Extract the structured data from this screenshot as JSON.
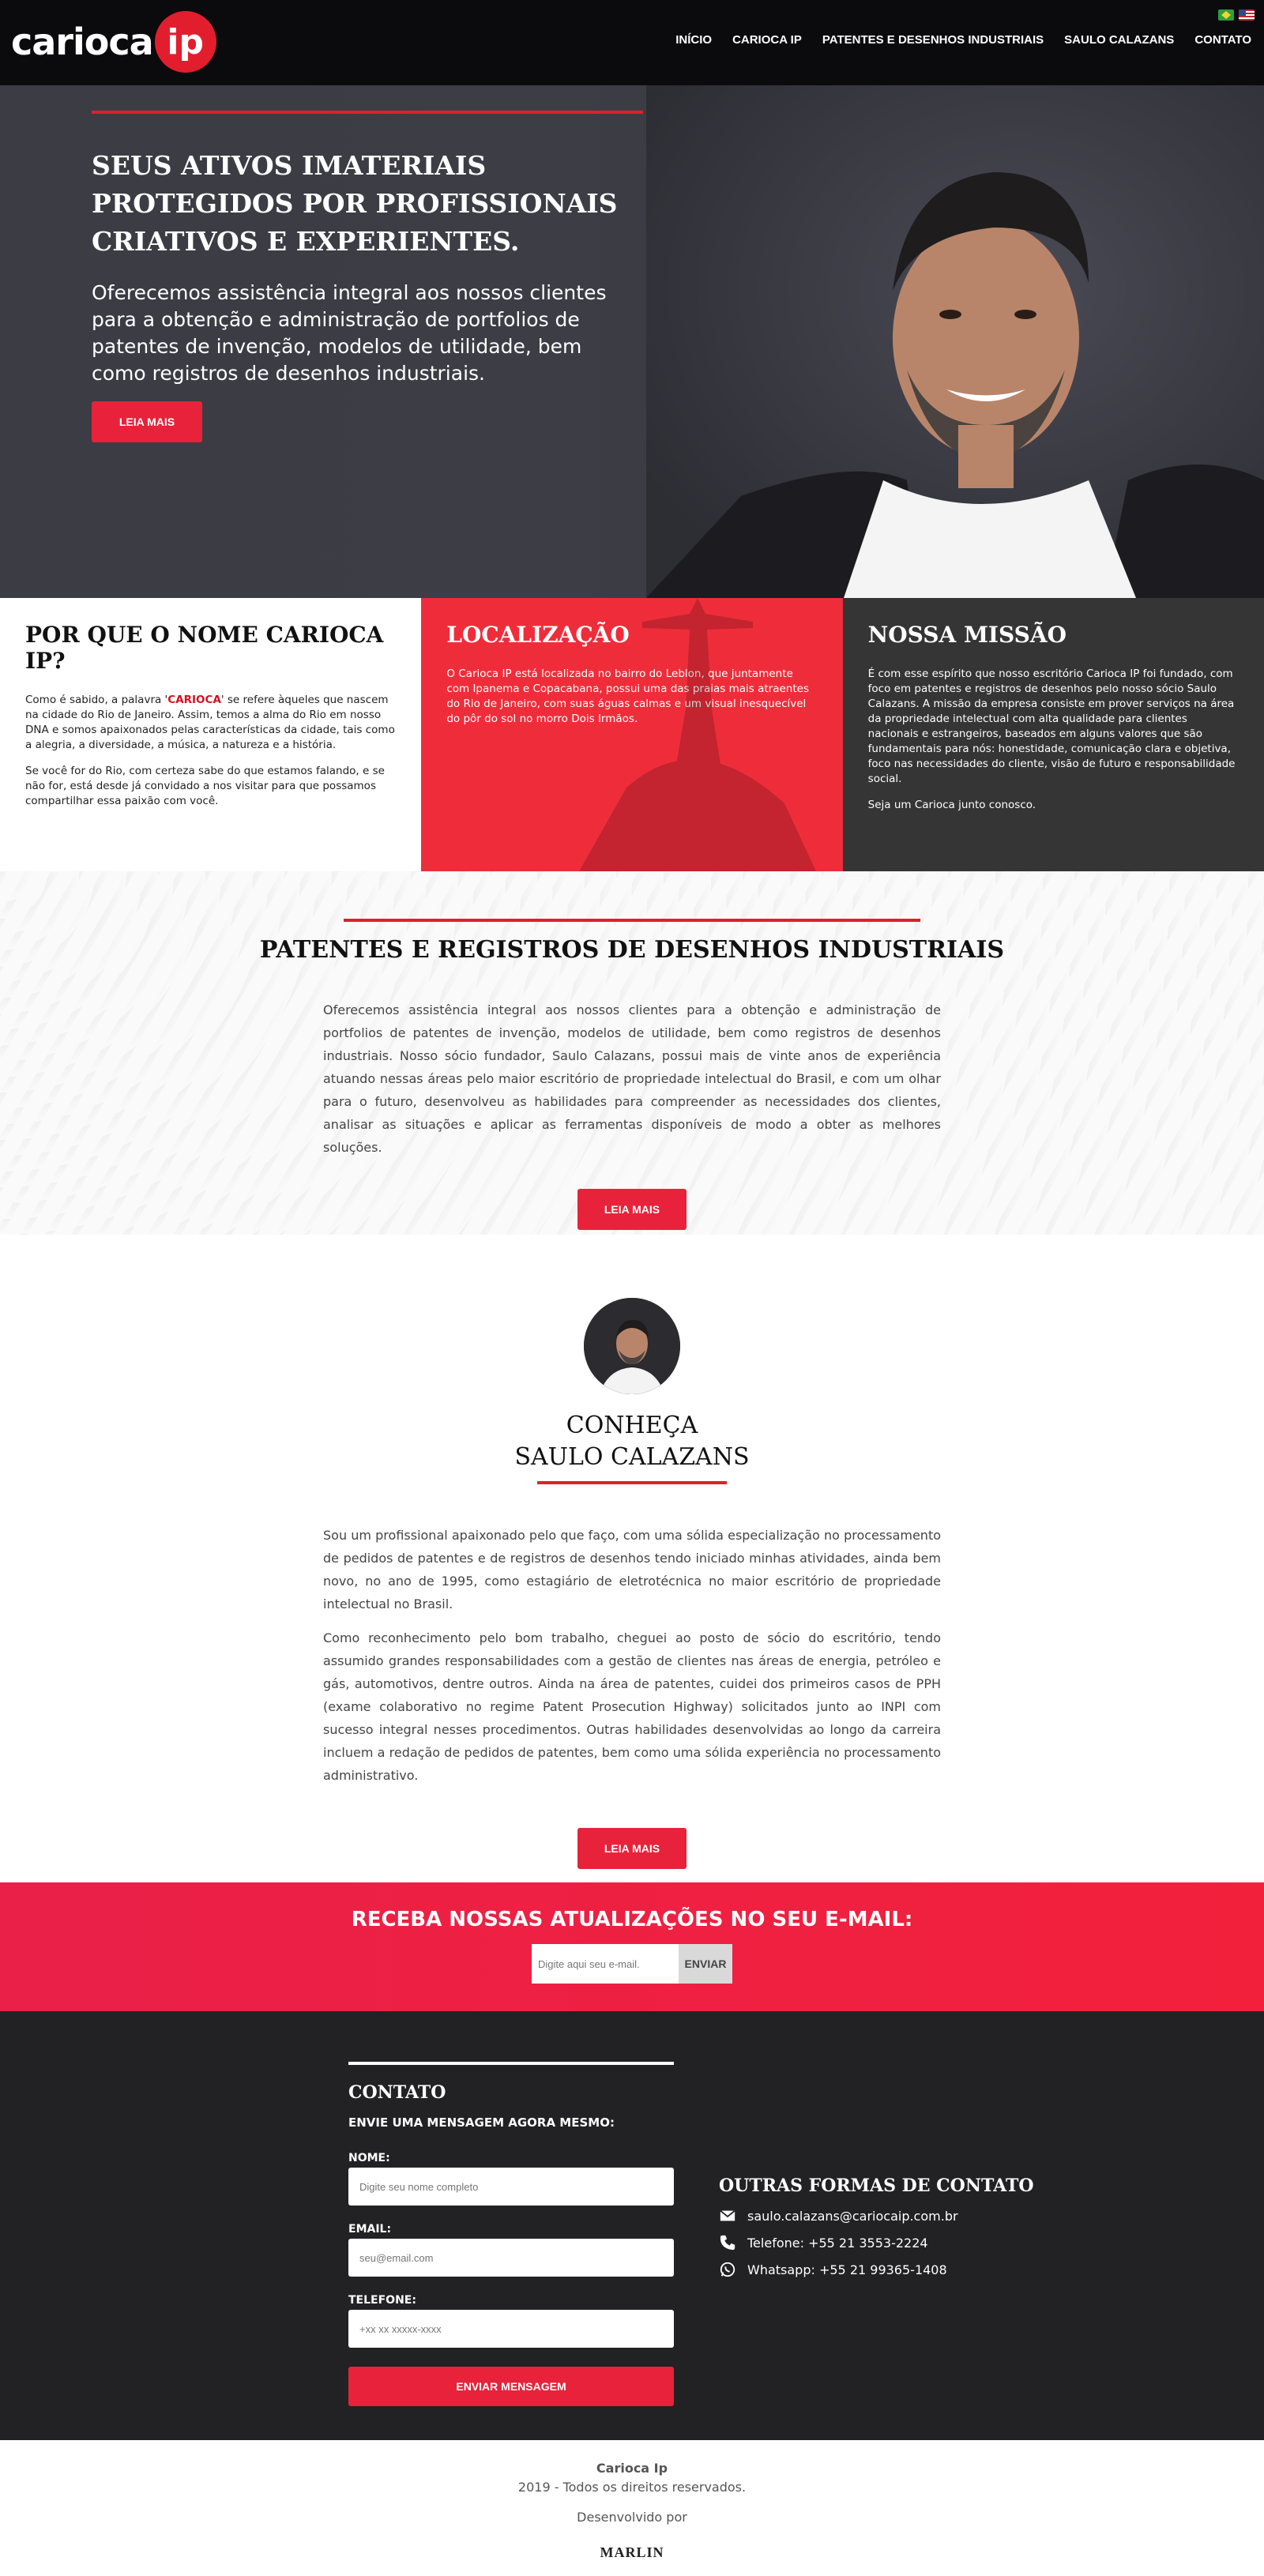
{
  "header": {
    "logo_text": "carioca",
    "logo_badge": "ip",
    "nav": [
      "INÍCIO",
      "CARIOCA IP",
      "PATENTES E DESENHOS INDUSTRIAIS",
      "SAULO CALAZANS",
      "CONTATO"
    ]
  },
  "hero": {
    "title": "SEUS ATIVOS IMATERIAIS PROTEGIDOS POR PROFISSIONAIS CRIATIVOS E EXPERIENTES.",
    "text": "Oferecemos assistência integral aos nossos clientes para a obtenção e administração de portfolios de patentes de invenção, modelos de utilidade, bem como registros de desenhos industriais.",
    "button": "LEIA MAIS"
  },
  "columns": {
    "why": {
      "title": "POR QUE O NOME CARIOCA IP?",
      "p1_a": "Como é sabido, a palavra '",
      "p1_highlight": "CARIOCA",
      "p1_b": "' se refere àqueles que nascem na cidade do Rio de Janeiro. Assim, temos a alma do Rio em nosso DNA e somos apaixonados pelas características da cidade, tais como a alegria, a diversidade, a música, a natureza e a história.",
      "p2": "Se você for do Rio, com certeza sabe do que estamos falando, e se não for, está desde já convidado a nos visitar para que possamos compartilhar essa paixão com você."
    },
    "location": {
      "title": "LOCALIZAÇÃO",
      "text": "O Carioca IP está localizada no bairro do Leblon, que juntamente com Ipanema e Copacabana, possui uma das praias mais atraentes do Rio de Janeiro, com suas águas calmas e um visual inesquecível do pôr do sol no morro Dois Irmãos."
    },
    "mission": {
      "title": "NOSSA MISSÃO",
      "text": "É com esse espírito que nosso escritório Carioca IP foi fundado, com foco em patentes e registros de desenhos pelo nosso sócio Saulo Calazans. A missão da empresa consiste em prover serviços na área da propriedade intelectual com alta qualidade para clientes nacionais e estrangeiros, baseados em alguns valores que são fundamentais para nós: honestidade, comunicação clara e objetiva, foco nas necessidades do cliente, visão de futuro e responsabilidade social.",
      "closing": "Seja um Carioca junto conosco."
    }
  },
  "patents": {
    "title": "PATENTES E REGISTROS DE DESENHOS INDUSTRIAIS",
    "text": "Oferecemos assistência integral aos nossos clientes para a obtenção e administração de portfolios de patentes de invenção, modelos de utilidade, bem como registros de desenhos industriais. Nosso sócio fundador, Saulo Calazans, possui mais de vinte anos de experiência atuando nessas áreas pelo maior escritório de propriedade intelectual do Brasil, e com um olhar para o futuro, desenvolveu as habilidades para compreender as necessidades dos clientes, analisar as situações e aplicar as ferramentas disponíveis de modo a obter as melhores soluções.",
    "button": "LEIA MAIS"
  },
  "saulo": {
    "title_line1": "CONHEÇA",
    "title_line2": "SAULO CALAZANS",
    "p1": "Sou um profissional apaixonado pelo que faço, com uma sólida especialização no processamento de pedidos de patentes e de registros de desenhos tendo iniciado minhas atividades, ainda bem novo, no ano de 1995, como estagiário de eletrotécnica no maior escritório de propriedade intelectual no Brasil.",
    "p2": "Como reconhecimento pelo bom trabalho, cheguei ao posto de sócio do escritório, tendo assumido grandes responsabilidades com a gestão de clientes nas áreas de energia, petróleo e gás, automotivos, dentre outros. Ainda na área de patentes, cuidei dos primeiros casos de PPH (exame colaborativo no regime Patent Prosecution Highway) solicitados junto ao INPI com sucesso integral nesses procedimentos. Outras habilidades desenvolvidas ao longo da carreira incluem a redação de pedidos de patentes, bem como uma sólida experiência no processamento administrativo.",
    "button": "LEIA MAIS"
  },
  "newsletter": {
    "title": "RECEBA NOSSAS ATUALIZAÇÕES NO SEU E-MAIL:",
    "placeholder": "Digite aqui seu e-mail.",
    "button": "ENVIAR"
  },
  "contact": {
    "title": "CONTATO",
    "subtitle": "ENVIE UMA MENSAGEM AGORA MESMO:",
    "name_label": "NOME:",
    "name_placeholder": "Digite seu nome completo",
    "email_label": "EMAIL:",
    "email_placeholder": "seu@email.com",
    "phone_label": "TELEFONE:",
    "phone_placeholder": "+xx xx xxxxx-xxxx",
    "button": "ENVIAR MENSAGEM",
    "other_title": "OUTRAS FORMAS DE CONTATO",
    "email": "saulo.calazans@cariocaip.com.br",
    "phone": "Telefone: +55 21 3553-2224",
    "whatsapp": "Whatsapp: +55 21 99365-1408"
  },
  "footer": {
    "company": "Carioca Ip",
    "rights": "2019 - Todos os direitos reservados.",
    "dev": "Desenvolvido por",
    "dev_brand": "MARLIN"
  },
  "colors": {
    "accent": "#e21e2e",
    "dark": "#0b0b0d",
    "location_bg": "#ef2d3a",
    "mission_bg": "#353535",
    "contact_bg": "#222224"
  }
}
